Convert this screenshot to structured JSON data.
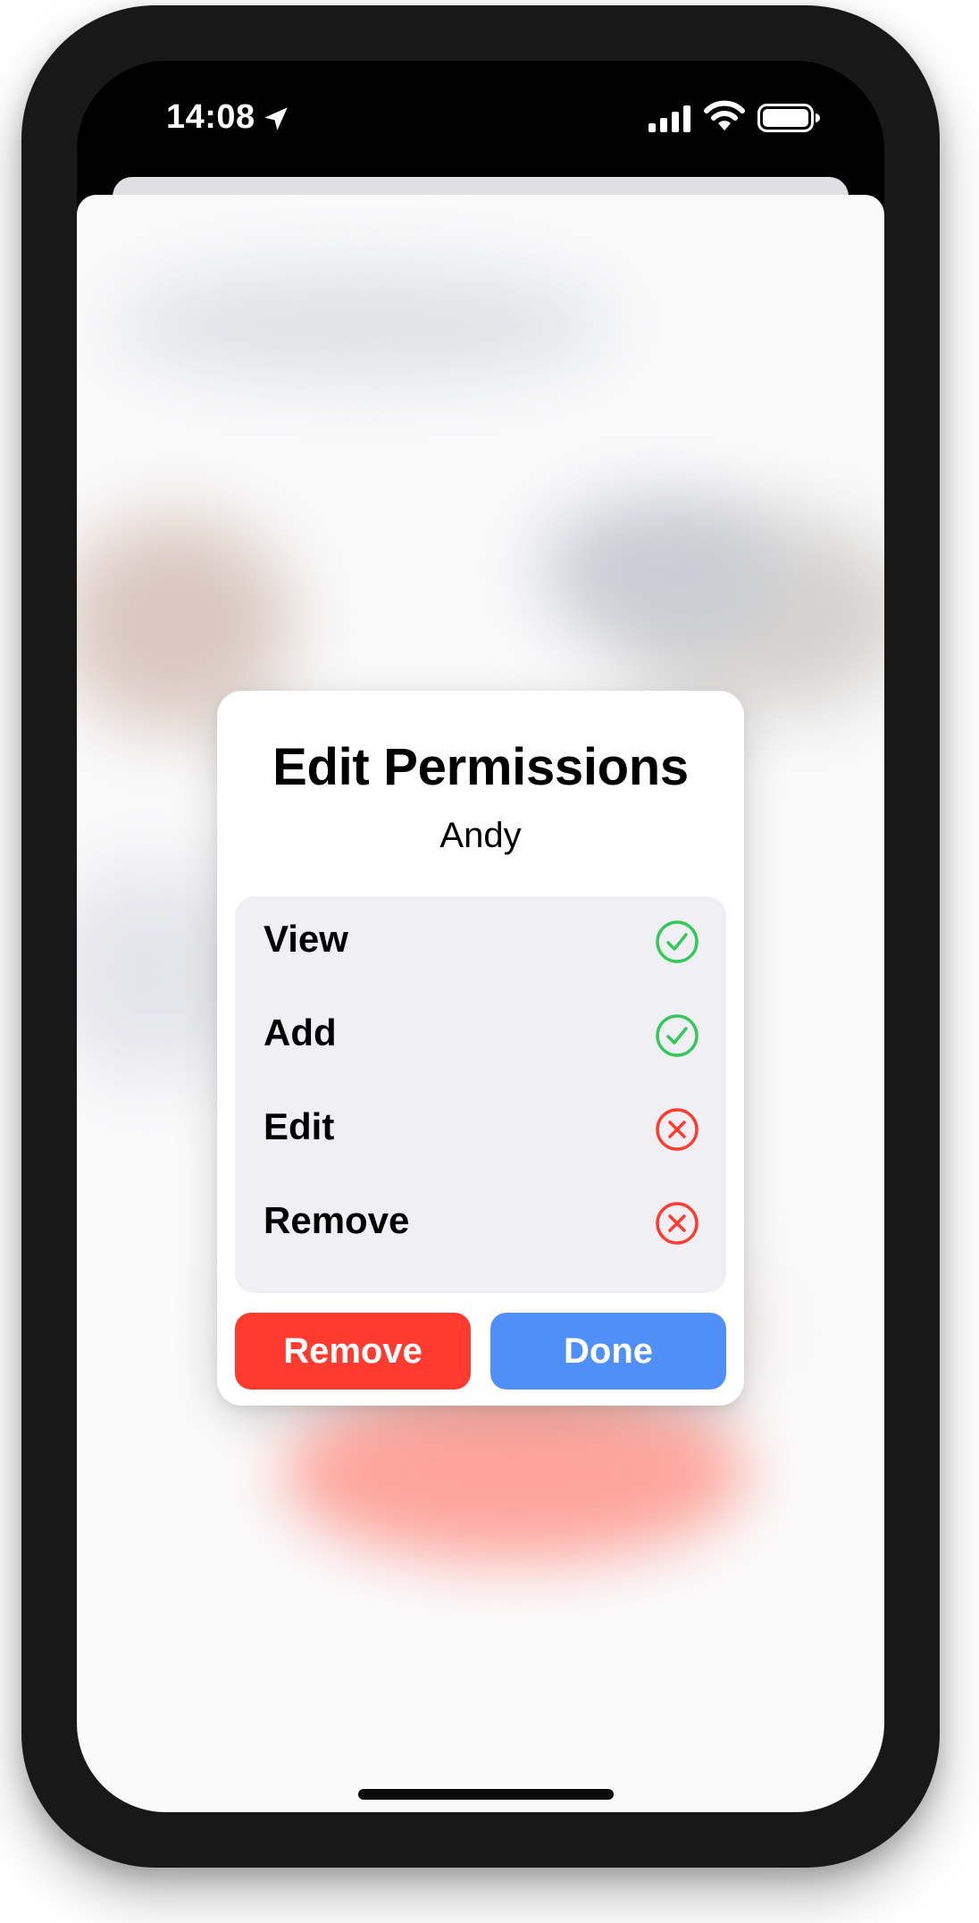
{
  "status_bar": {
    "time": "14:08",
    "icons": [
      "location-arrow-icon",
      "cellular-signal-icon",
      "wifi-icon",
      "battery-icon"
    ]
  },
  "dialog": {
    "title": "Edit Permissions",
    "subtitle": "Andy",
    "permissions": [
      {
        "label": "View",
        "granted": true,
        "icon": "check-circle-icon"
      },
      {
        "label": "Add",
        "granted": true,
        "icon": "check-circle-icon"
      },
      {
        "label": "Edit",
        "granted": false,
        "icon": "x-circle-icon"
      },
      {
        "label": "Remove",
        "granted": false,
        "icon": "x-circle-icon"
      }
    ],
    "buttons": {
      "remove_label": "Remove",
      "done_label": "Done"
    }
  },
  "colors": {
    "granted": "#34c759",
    "denied": "#ff3b30",
    "remove_button": "#ff3b30",
    "done_button": "#4f8ff7"
  }
}
